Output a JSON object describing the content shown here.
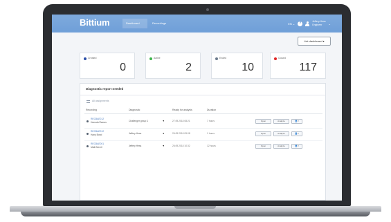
{
  "app": {
    "logo": "Bittium"
  },
  "nav": {
    "tabs": [
      {
        "label": "Dashboard"
      },
      {
        "label": "Recordings"
      }
    ]
  },
  "header": {
    "lang": "EN ⌄",
    "help": "?",
    "user_name": "Jeffery Hess",
    "user_role": "Engineer",
    "chevron": "⌄"
  },
  "toolbar": {
    "list_button": "List dashboard ▾"
  },
  "status_cards": [
    {
      "label": "Created",
      "value": "0",
      "color": "#2b4fa8"
    },
    {
      "label": "Active",
      "value": "2",
      "color": "#3cb44b"
    },
    {
      "label": "Ended",
      "value": "10",
      "color": "#6b7a8c"
    },
    {
      "label": "Closed",
      "value": "117",
      "color": "#e02626"
    }
  ],
  "report_panel": {
    "title": "Diagnostic report needed",
    "sub_link": "All assignments",
    "columns": [
      "Recording",
      "Diagnostic",
      "Ready for analysis",
      "Duration"
    ],
    "rows": [
      {
        "id": "RECBAE012",
        "name": "Hanoda Ramos",
        "diagnostic": "Challenger group 1",
        "date": "27.09.2018 08:21",
        "duration": "7 hours"
      },
      {
        "id": "RECBAE012",
        "name": "Hany Bond",
        "diagnostic": "Jeffery Hess",
        "date": "26.09.2018 09:08",
        "duration": "1 hours"
      },
      {
        "id": "RECBAE001",
        "name": "Matti Nevril",
        "diagnostic": "Jeffery Hess",
        "date": "26.09.2018 10:32",
        "duration": "12 hours"
      }
    ],
    "row_actions": {
      "open": "Open",
      "analyze": "Analyze",
      "assign": "👤▾"
    },
    "caret": "▼"
  }
}
